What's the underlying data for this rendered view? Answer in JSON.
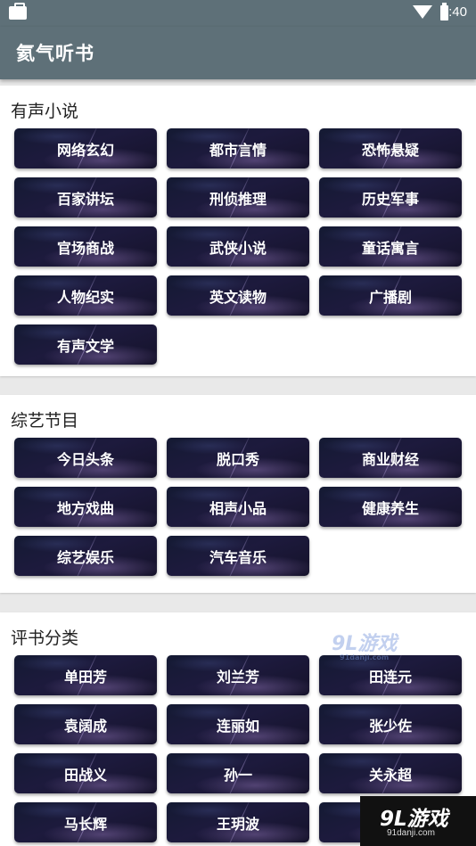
{
  "status": {
    "time": "2:40"
  },
  "app": {
    "title": "氦气听书"
  },
  "sections": [
    {
      "title": "有声小说",
      "items": [
        "网络玄幻",
        "都市言情",
        "恐怖悬疑",
        "百家讲坛",
        "刑侦推理",
        "历史军事",
        "官场商战",
        "武侠小说",
        "童话寓言",
        "人物纪实",
        "英文读物",
        "广播剧",
        "有声文学"
      ]
    },
    {
      "title": "综艺节目",
      "items": [
        "今日头条",
        "脱口秀",
        "商业财经",
        "地方戏曲",
        "相声小品",
        "健康养生",
        "综艺娱乐",
        "汽车音乐"
      ]
    },
    {
      "title": "评书分类",
      "items": [
        "单田芳",
        "刘兰芳",
        "田连元",
        "袁阔成",
        "连丽如",
        "张少佐",
        "田战义",
        "孙一",
        "关永超",
        "马长辉",
        "王玥波",
        ""
      ]
    }
  ],
  "watermark": {
    "brand": "9L游戏",
    "url": "91danji.com"
  }
}
